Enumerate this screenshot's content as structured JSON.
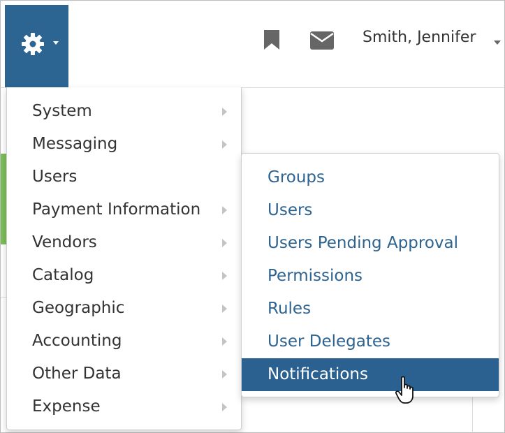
{
  "header": {
    "user_name": "Smith, Jennifer"
  },
  "main_menu": {
    "items": [
      {
        "label": "System",
        "submenu": true
      },
      {
        "label": "Messaging",
        "submenu": true
      },
      {
        "label": "Users",
        "submenu": false
      },
      {
        "label": "Payment Information",
        "submenu": true
      },
      {
        "label": "Vendors",
        "submenu": true
      },
      {
        "label": "Catalog",
        "submenu": true
      },
      {
        "label": "Geographic",
        "submenu": true
      },
      {
        "label": "Accounting",
        "submenu": true
      },
      {
        "label": "Other Data",
        "submenu": true
      },
      {
        "label": "Expense",
        "submenu": true
      }
    ]
  },
  "sub_menu": {
    "items": [
      {
        "label": "Groups"
      },
      {
        "label": "Users"
      },
      {
        "label": "Users Pending Approval"
      },
      {
        "label": "Permissions"
      },
      {
        "label": "Rules"
      },
      {
        "label": "User Delegates"
      },
      {
        "label": "Notifications",
        "active": true
      }
    ]
  },
  "colors": {
    "header_button_bg": "#2c6592",
    "submenu_link": "#2e6390",
    "active_item_bg": "#2a6190"
  },
  "icons": [
    "gear-icon",
    "bookmark-icon",
    "mail-icon",
    "pointer-cursor-icon"
  ]
}
